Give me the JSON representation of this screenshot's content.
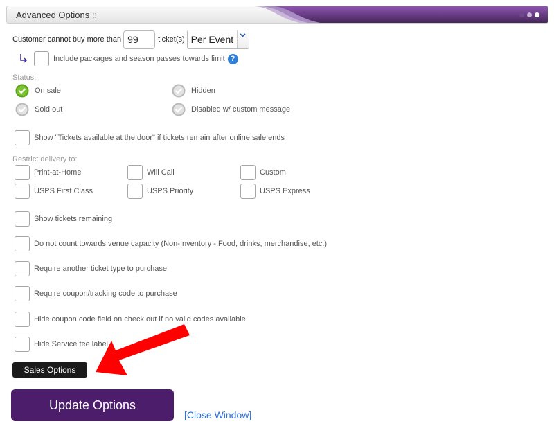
{
  "header": {
    "title": "Advanced Options ::",
    "dots": [
      "#6b4a86",
      "#c8b6d6",
      "#ffffff"
    ],
    "accent_color": "#6b3d93"
  },
  "limit": {
    "prefix": "Customer cannot buy more than",
    "quantity": "99",
    "suffix": "ticket(s)",
    "scope_selected": "Per Event",
    "include_packages_label": "Include packages and season passes towards limit",
    "include_packages_checked": false,
    "help_icon": "?"
  },
  "status": {
    "label": "Status:",
    "options": [
      {
        "label": "On sale",
        "selected": true
      },
      {
        "label": "Hidden",
        "selected": false
      },
      {
        "label": "Sold out",
        "selected": false
      },
      {
        "label": "Disabled w/ custom message",
        "selected": false
      }
    ]
  },
  "door_option": {
    "label": "Show \"Tickets available at the door\" if tickets remain after online sale ends",
    "checked": false
  },
  "delivery": {
    "label": "Restrict delivery to:",
    "options": [
      {
        "label": "Print-at-Home",
        "checked": false
      },
      {
        "label": "Will Call",
        "checked": false
      },
      {
        "label": "Custom",
        "checked": false
      },
      {
        "label": "USPS First Class",
        "checked": false
      },
      {
        "label": "USPS Priority",
        "checked": false
      },
      {
        "label": "USPS Express",
        "checked": false
      }
    ]
  },
  "options": [
    {
      "label": "Show tickets remaining",
      "checked": false
    },
    {
      "label": "Do not count towards venue capacity (Non-Inventory - Food, drinks, merchandise, etc.)",
      "checked": false
    },
    {
      "label": "Require another ticket type to purchase",
      "checked": false
    },
    {
      "label": "Require coupon/tracking code to purchase",
      "checked": false
    },
    {
      "label": "Hide coupon code field on check out if no valid codes available",
      "checked": false
    },
    {
      "label": "Hide Service fee label",
      "checked": false
    }
  ],
  "buttons": {
    "sales_options": "Sales Options",
    "update_options": "Update Options",
    "close_window": "[Close Window]"
  },
  "annotation": {
    "arrow_color": "#ff0000"
  }
}
